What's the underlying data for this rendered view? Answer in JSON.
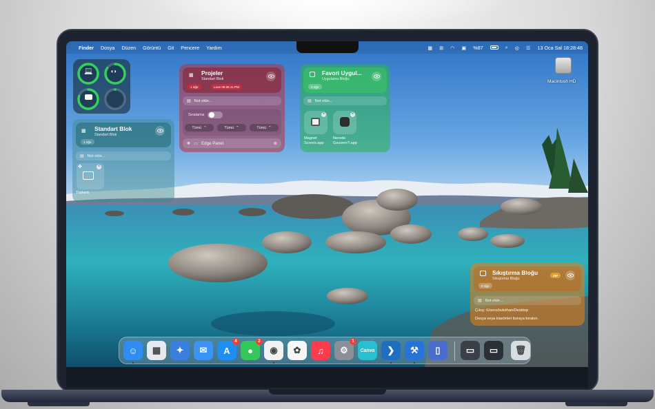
{
  "menubar": {
    "apple": "",
    "items": [
      "Finder",
      "Dosya",
      "Düzen",
      "Görüntü",
      "Git",
      "Pencere",
      "Yardım"
    ],
    "battery_percent": "%87",
    "datetime": "13 Oca Sal  18:28:48"
  },
  "desktop": {
    "drive_label": "Macintosh HD"
  },
  "battery_widget": {
    "levels": [
      1.0,
      0.85,
      0.8,
      0.0
    ]
  },
  "standart_blok": {
    "title": "Standart Blok",
    "subtitle": "Standart Blok",
    "count_pill": "1 öğe",
    "note_placeholder": "Not ekle...",
    "folder_label": "Toplantı"
  },
  "projeler": {
    "title": "Projeler",
    "subtitle": "Standart Blok",
    "pill1": "1 öğe",
    "pill2": "Love 09.06.11.PM",
    "note_placeholder": "Not ekle...",
    "sort_label": "Sıralama",
    "filters": [
      "Tümü",
      "Tümü",
      "Tümü"
    ],
    "panel_item": "Edge Panel"
  },
  "favori": {
    "title": "Favori Uygul...",
    "subtitle": "Uygulama Bloğu",
    "count_pill": "2 öğe",
    "note_placeholder": "Not ekle...",
    "apps": [
      "Magnet\nScreen.app",
      "Nerede\nGezsem?.app"
    ]
  },
  "sikistirma": {
    "title": "Sıkıştırma Bloğu",
    "subtitle": "Sıkıştırma Bloğu",
    "zip_badge": "ZIP",
    "count_pill": "0 öğe",
    "note_placeholder": "Not ekle...",
    "output_path": "Çıkış: /Users/buluthan/Desktop",
    "hint": "Dosya veya klasörleri buraya bırakın."
  },
  "dock": {
    "apps": [
      {
        "name": "Finder",
        "badge": "",
        "color": "#2f8cf0",
        "glyph": "☺"
      },
      {
        "name": "Launchpad",
        "badge": "",
        "color": "#e6e9f0",
        "glyph": "▦"
      },
      {
        "name": "Cleaner",
        "badge": "",
        "color": "#3a7ee0",
        "glyph": "✦"
      },
      {
        "name": "Mail",
        "badge": "",
        "color": "#3d93f5",
        "glyph": "✉"
      },
      {
        "name": "App Store",
        "badge": "4",
        "color": "#1f8df2",
        "glyph": "A"
      },
      {
        "name": "Messages",
        "badge": "2",
        "color": "#35c759",
        "glyph": "●"
      },
      {
        "name": "Chrome",
        "badge": "",
        "color": "#f2f2f2",
        "glyph": "◉"
      },
      {
        "name": "Photos",
        "badge": "",
        "color": "#f6f6f6",
        "glyph": "✿"
      },
      {
        "name": "Music",
        "badge": "",
        "color": "#fa3c4c",
        "glyph": "♫"
      },
      {
        "name": "System Settings",
        "badge": "1",
        "color": "#8a8f98",
        "glyph": "⚙"
      },
      {
        "name": "Canva",
        "badge": "",
        "color": "#27c0d1",
        "glyph": "Canva"
      },
      {
        "name": "VS Code",
        "badge": "",
        "color": "#1f6fc1",
        "glyph": "❯"
      },
      {
        "name": "Xcode",
        "badge": "",
        "color": "#2674d9",
        "glyph": "⚒"
      },
      {
        "name": "Simulator",
        "badge": "",
        "color": "#4a6ccd",
        "glyph": "▯"
      },
      {
        "name": "Window",
        "badge": "",
        "color": "#3a3f48",
        "glyph": "▭"
      },
      {
        "name": "Window 2",
        "badge": "",
        "color": "#2b2f36",
        "glyph": "▭"
      },
      {
        "name": "Trash",
        "badge": "",
        "color": "#d8dde2",
        "glyph": "🗑"
      }
    ]
  },
  "colors": {
    "projeler": "#b8323f",
    "favori": "#2bb34f",
    "sikistirma": "#e07f1b",
    "standart": "#3d8a8c"
  }
}
